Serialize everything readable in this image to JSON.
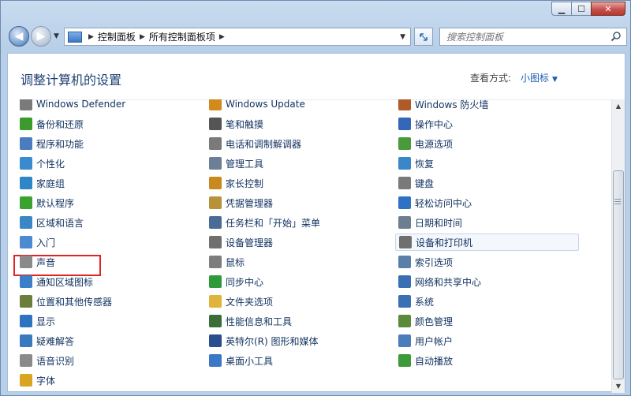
{
  "window": {
    "caption": {
      "minimize": "▁",
      "maximize": "☐",
      "close": "✕"
    }
  },
  "nav": {
    "breadcrumbs": [
      "控制面板",
      "所有控制面板项"
    ],
    "search_placeholder": "搜索控制面板"
  },
  "header": {
    "title": "调整计算机的设置",
    "view_label": "查看方式:",
    "view_value": "小图标"
  },
  "columns": [
    [
      {
        "label": "Windows Defender",
        "icon": "defender-icon",
        "color": "#7a7a7a"
      },
      {
        "label": "备份和还原",
        "icon": "backup-icon",
        "color": "#3d9a2e"
      },
      {
        "label": "程序和功能",
        "icon": "programs-icon",
        "color": "#4c7bbf"
      },
      {
        "label": "个性化",
        "icon": "personalization-icon",
        "color": "#3a8ad0"
      },
      {
        "label": "家庭组",
        "icon": "homegroup-icon",
        "color": "#2f86c7"
      },
      {
        "label": "默认程序",
        "icon": "default-programs-icon",
        "color": "#3aa32f"
      },
      {
        "label": "区域和语言",
        "icon": "region-icon",
        "color": "#3b86c6"
      },
      {
        "label": "入门",
        "icon": "getting-started-icon",
        "color": "#4c8ad2"
      },
      {
        "label": "声音",
        "icon": "speaker-icon",
        "color": "#8a8a8a"
      },
      {
        "label": "通知区域图标",
        "icon": "notification-icon",
        "color": "#3a7fc8"
      },
      {
        "label": "位置和其他传感器",
        "icon": "sensor-icon",
        "color": "#6c7f3a"
      },
      {
        "label": "显示",
        "icon": "display-icon",
        "color": "#2d73bf"
      },
      {
        "label": "疑难解答",
        "icon": "troubleshoot-icon",
        "color": "#3b79bf"
      },
      {
        "label": "语音识别",
        "icon": "microphone-icon",
        "color": "#8a8a8a"
      },
      {
        "label": "字体",
        "icon": "fonts-icon",
        "color": "#d9a521"
      }
    ],
    [
      {
        "label": "Windows Update",
        "icon": "update-icon",
        "color": "#d28a1c"
      },
      {
        "label": "笔和触摸",
        "icon": "pen-icon",
        "color": "#555555"
      },
      {
        "label": "电话和调制解调器",
        "icon": "phone-icon",
        "color": "#7a7a7a"
      },
      {
        "label": "管理工具",
        "icon": "admin-tools-icon",
        "color": "#6d7f94"
      },
      {
        "label": "家长控制",
        "icon": "parental-icon",
        "color": "#c8891f"
      },
      {
        "label": "凭据管理器",
        "icon": "credential-icon",
        "color": "#b8923a"
      },
      {
        "label": "任务栏和「开始」菜单",
        "icon": "taskbar-icon",
        "color": "#4a6b95"
      },
      {
        "label": "设备管理器",
        "icon": "device-manager-icon",
        "color": "#6f6f6f"
      },
      {
        "label": "鼠标",
        "icon": "mouse-icon",
        "color": "#7d7d7d"
      },
      {
        "label": "同步中心",
        "icon": "sync-icon",
        "color": "#2f9a3a"
      },
      {
        "label": "文件夹选项",
        "icon": "folder-icon",
        "color": "#e0b43a"
      },
      {
        "label": "性能信息和工具",
        "icon": "performance-icon",
        "color": "#3b6d3a"
      },
      {
        "label": "英特尔(R) 图形和媒体",
        "icon": "intel-icon",
        "color": "#2a4d8f"
      },
      {
        "label": "桌面小工具",
        "icon": "gadgets-icon",
        "color": "#3b78c5"
      }
    ],
    [
      {
        "label": "Windows 防火墙",
        "icon": "firewall-icon",
        "color": "#b05a2a"
      },
      {
        "label": "操作中心",
        "icon": "flag-icon",
        "color": "#3567b8"
      },
      {
        "label": "电源选项",
        "icon": "power-icon",
        "color": "#4a9a3b"
      },
      {
        "label": "恢复",
        "icon": "recovery-icon",
        "color": "#3a86c9"
      },
      {
        "label": "键盘",
        "icon": "keyboard-icon",
        "color": "#7a7a7a"
      },
      {
        "label": "轻松访问中心",
        "icon": "ease-access-icon",
        "color": "#2f72c4"
      },
      {
        "label": "日期和时间",
        "icon": "clock-icon",
        "color": "#6d7e92"
      },
      {
        "label": "设备和打印机",
        "icon": "printer-icon",
        "color": "#6f6f6f"
      },
      {
        "label": "索引选项",
        "icon": "index-icon",
        "color": "#5a7fa8"
      },
      {
        "label": "网络和共享中心",
        "icon": "network-icon",
        "color": "#3a6fb3"
      },
      {
        "label": "系统",
        "icon": "system-icon",
        "color": "#3b6fb6"
      },
      {
        "label": "颜色管理",
        "icon": "color-icon",
        "color": "#5a8a3a"
      },
      {
        "label": "用户帐户",
        "icon": "user-icon",
        "color": "#4b7db8"
      },
      {
        "label": "自动播放",
        "icon": "autoplay-icon",
        "color": "#3d9a3a"
      }
    ]
  ]
}
